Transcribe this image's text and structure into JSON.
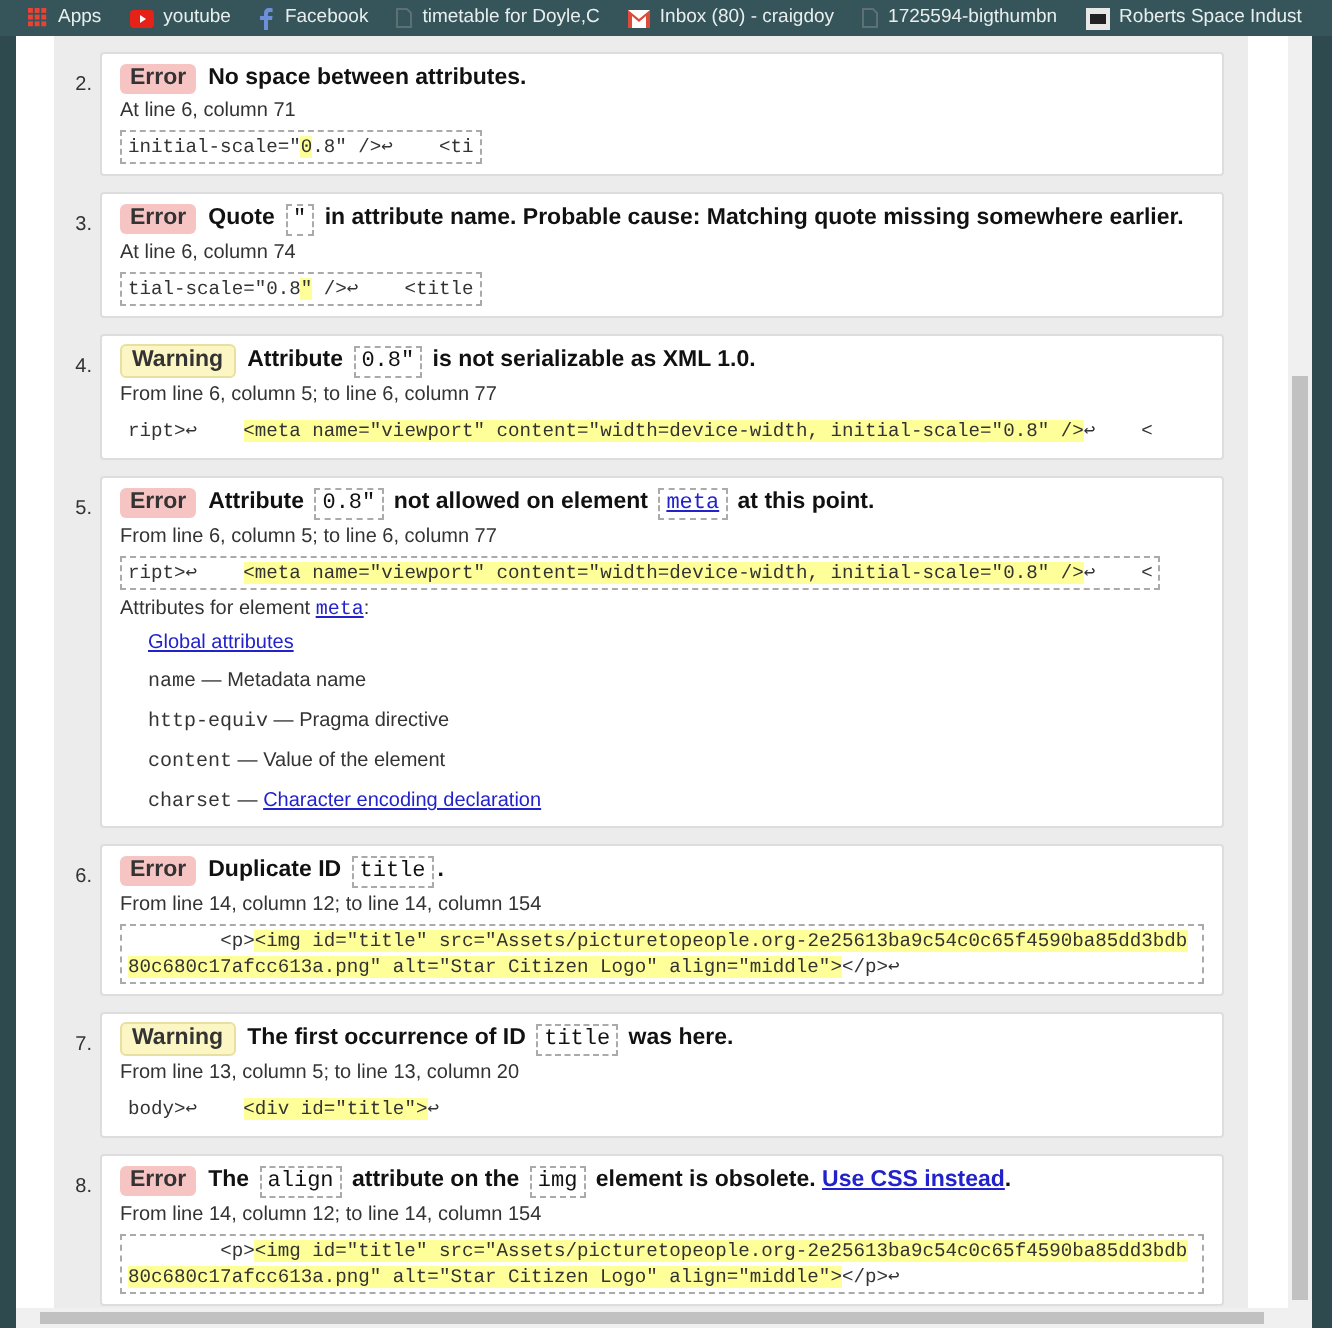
{
  "bookmarks": [
    {
      "kind": "apps",
      "label": "Apps"
    },
    {
      "kind": "video",
      "label": "youtube"
    },
    {
      "kind": "social",
      "label": "Facebook"
    },
    {
      "kind": "page",
      "label": "timetable for Doyle,C"
    },
    {
      "kind": "mail",
      "label": "Inbox (80) - craigdoy"
    },
    {
      "kind": "page",
      "label": "1725594-bigthumbn"
    },
    {
      "kind": "logo",
      "label": "Roberts Space Indust"
    }
  ],
  "messages": [
    {
      "number": "2.",
      "kind": "error",
      "badge": "Error",
      "parts": [
        {
          "kind": "text",
          "text": "No space between attributes."
        }
      ],
      "location": "At line 6, column 71",
      "extract": {
        "boxed": true,
        "before": "initial-scale=\"",
        "highlight": "0",
        "after": ".8\" />↩    <ti"
      }
    },
    {
      "number": "3.",
      "kind": "error",
      "badge": "Error",
      "parts": [
        {
          "kind": "text",
          "text": "Quote "
        },
        {
          "kind": "code",
          "text": "\""
        },
        {
          "kind": "text",
          "text": " in attribute name. Probable cause: Matching quote missing somewhere earlier."
        }
      ],
      "location": "At line 6, column 74",
      "extract": {
        "boxed": true,
        "before": "tial-scale=\"0.8",
        "highlight": "\"",
        "after": " />↩    <title"
      }
    },
    {
      "number": "4.",
      "kind": "warning",
      "badge": "Warning",
      "parts": [
        {
          "kind": "text",
          "text": "Attribute "
        },
        {
          "kind": "code",
          "text": "0.8\""
        },
        {
          "kind": "text",
          "text": " is not serializable as XML 1.0."
        }
      ],
      "location": "From line 6, column 5; to line 6, column 77",
      "extract": {
        "boxed": false,
        "before": "ript>↩    ",
        "highlight": "<meta name=\"viewport\" content=\"width=device-width, initial-scale=\"0.8\" />",
        "after": "↩    <"
      }
    },
    {
      "number": "5.",
      "kind": "error",
      "badge": "Error",
      "parts": [
        {
          "kind": "text",
          "text": "Attribute "
        },
        {
          "kind": "code",
          "text": "0.8\""
        },
        {
          "kind": "text",
          "text": " not allowed on element "
        },
        {
          "kind": "codelink",
          "text": "meta"
        },
        {
          "kind": "text",
          "text": " at this point."
        }
      ],
      "location": "From line 6, column 5; to line 6, column 77",
      "extract": {
        "boxed": true,
        "before": "ript>↩    ",
        "highlight": "<meta name=\"viewport\" content=\"width=device-width, initial-scale=\"0.8\" />",
        "after": "↩    <"
      },
      "attributes": {
        "intro": "Attributes for element ",
        "element": "meta",
        "colon": ":",
        "global": "Global attributes",
        "items": [
          {
            "name": "name",
            "dash": "—",
            "description": "Metadata name",
            "link": false
          },
          {
            "name": "http-equiv",
            "dash": "—",
            "description": "Pragma directive",
            "link": false
          },
          {
            "name": "content",
            "dash": "—",
            "description": "Value of the element",
            "link": false
          },
          {
            "name": "charset",
            "dash": "—",
            "description": "Character encoding declaration",
            "link": true
          }
        ]
      }
    },
    {
      "number": "6.",
      "kind": "error",
      "badge": "Error",
      "parts": [
        {
          "kind": "text",
          "text": "Duplicate ID "
        },
        {
          "kind": "code",
          "text": "title"
        },
        {
          "kind": "text",
          "text": "."
        }
      ],
      "location": "From line 14, column 12; to line 14, column 154",
      "extract": {
        "boxed": true,
        "before": "        <p>",
        "highlight": "<img id=\"title\" src=\"Assets/picturetopeople.org-2e25613ba9c54c0c65f4590ba85dd3bdb80c680c17afcc613a.png\" alt=\"Star Citizen Logo\" align=\"middle\">",
        "after": "</p>↩"
      }
    },
    {
      "number": "7.",
      "kind": "warning",
      "badge": "Warning",
      "parts": [
        {
          "kind": "text",
          "text": "The first occurrence of ID "
        },
        {
          "kind": "code",
          "text": "title"
        },
        {
          "kind": "text",
          "text": " was here."
        }
      ],
      "location": "From line 13, column 5; to line 13, column 20",
      "extract": {
        "boxed": false,
        "before": "body>↩    ",
        "highlight": "<div id=\"title\">",
        "after": "↩"
      }
    },
    {
      "number": "8.",
      "kind": "error",
      "badge": "Error",
      "parts": [
        {
          "kind": "text",
          "text": "The "
        },
        {
          "kind": "code",
          "text": "align"
        },
        {
          "kind": "text",
          "text": " attribute on the "
        },
        {
          "kind": "code",
          "text": "img"
        },
        {
          "kind": "text",
          "text": " element is obsolete. "
        },
        {
          "kind": "link",
          "text": "Use CSS instead"
        },
        {
          "kind": "text",
          "text": "."
        }
      ],
      "location": "From line 14, column 12; to line 14, column 154",
      "extract": {
        "boxed": true,
        "before": "        <p>",
        "highlight": "<img id=\"title\" src=\"Assets/picturetopeople.org-2e25613ba9c54c0c65f4590ba85dd3bdb80c680c17afcc613a.png\" alt=\"Star Citizen Logo\" align=\"middle\">",
        "after": "</p>↩"
      }
    }
  ]
}
